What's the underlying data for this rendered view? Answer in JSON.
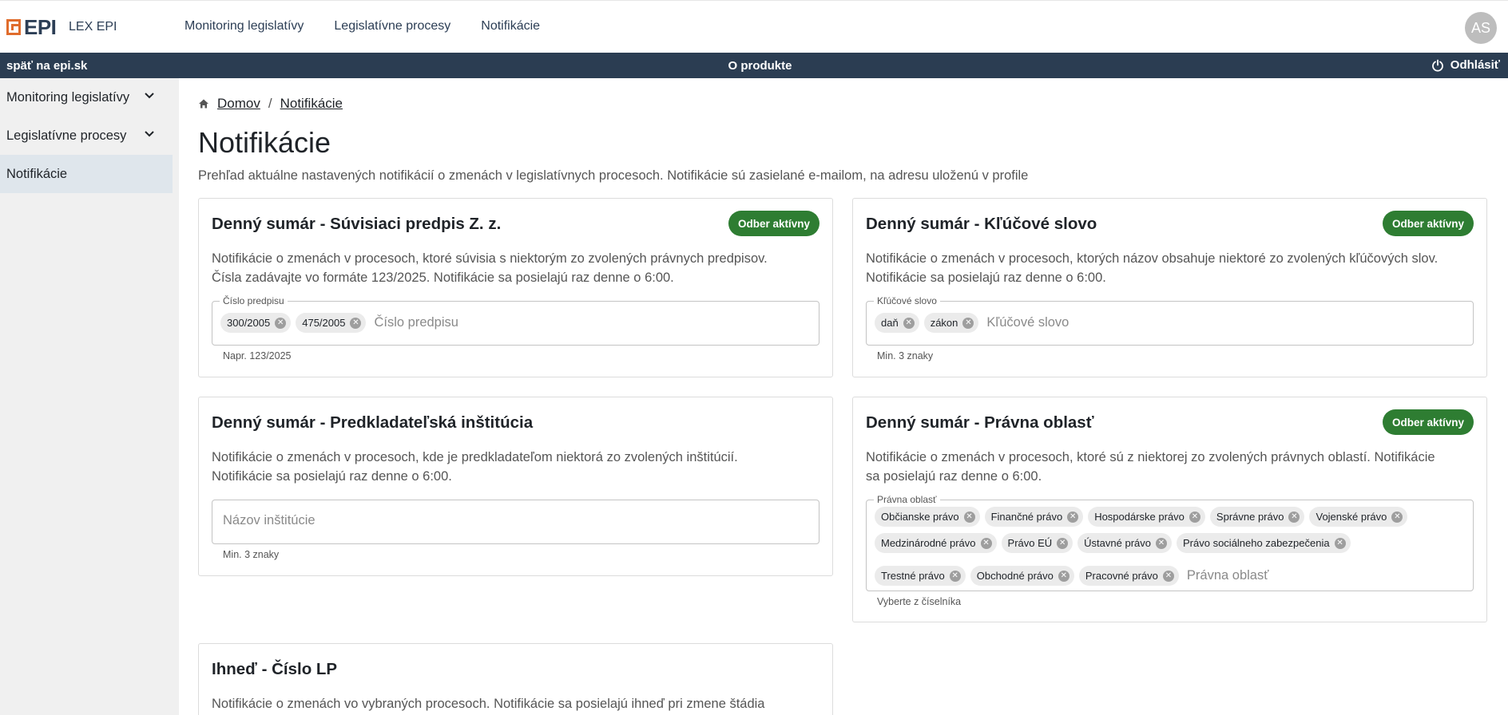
{
  "header": {
    "logo_text": "EPI",
    "product": "LEX EPI",
    "nav": [
      "Monitoring legislatívy",
      "Legislatívne procesy",
      "Notifikácie"
    ],
    "avatar": "AS"
  },
  "darkbar": {
    "back": "späť na epi.sk",
    "about": "O produkte",
    "logout": "Odhlásiť"
  },
  "sidebar": {
    "items": [
      {
        "label": "Monitoring legislatívy"
      },
      {
        "label": "Legislatívne procesy"
      },
      {
        "label": "Notifikácie"
      }
    ]
  },
  "breadcrumb": {
    "home": "Domov",
    "sep": "/",
    "current": "Notifikácie"
  },
  "page": {
    "title": "Notifikácie",
    "description": "Prehľad aktuálne nastavených notifikácií o zmenách v legislatívnych procesoch. Notifikácie sú zasielané e-mailom, na adresu uloženú v profile"
  },
  "cards": {
    "related": {
      "title": "Denný sumár - Súvisiaci predpis Z. z.",
      "badge": "Odber aktívny",
      "desc1": "Notifikácie o zmenách v procesoch, ktoré súvisia s niektorým zo zvolených právnych predpisov.",
      "desc2": "Čísla zadávajte vo formáte 123/2025. Notifikácie sa posielajú raz denne o 6:00.",
      "legend": "Číslo predpisu",
      "chips": [
        "300/2005",
        "475/2005"
      ],
      "placeholder": "Číslo predpisu",
      "helper": "Napr. 123/2025"
    },
    "keyword": {
      "title": "Denný sumár - Kľúčové slovo",
      "badge": "Odber aktívny",
      "desc1": "Notifikácie o zmenách v procesoch, ktorých názov obsahuje niektoré zo zvolených kľúčových slov.",
      "desc2": "Notifikácie sa posielajú raz denne o 6:00.",
      "legend": "Kľúčové slovo",
      "chips": [
        "daň",
        "zákon"
      ],
      "placeholder": "Kľúčové slovo",
      "helper": "Min. 3 znaky"
    },
    "institution": {
      "title": "Denný sumár - Predkladateľská inštitúcia",
      "desc1": "Notifikácie o zmenách v procesoch, kde je predkladateľom niektorá zo zvolených inštitúcií.",
      "desc2": "Notifikácie sa posielajú raz denne o 6:00.",
      "placeholder": "Názov inštitúcie",
      "helper": "Min. 3 znaky"
    },
    "area": {
      "title": "Denný sumár - Právna oblasť",
      "badge": "Odber aktívny",
      "desc1": "Notifikácie o zmenách v procesoch, ktoré sú z niektorej zo zvolených právnych oblastí. Notifikácie",
      "desc2": "sa posielajú raz denne o 6:00.",
      "legend": "Právna oblasť",
      "chips": [
        "Občianske právo",
        "Finančné právo",
        "Hospodárske právo",
        "Správne právo",
        "Vojenské právo",
        "Medzinárodné právo",
        "Právo EÚ",
        "Ústavné právo",
        "Právo sociálneho zabezpečenia",
        "Trestné právo",
        "Obchodné právo",
        "Pracovné právo"
      ],
      "placeholder": "Právna oblasť",
      "helper": "Vyberte z číselníka"
    },
    "immediate": {
      "title": "Ihneď - Číslo LP",
      "desc1": "Notifikácie o zmenách vo vybraných procesoch. Notifikácie sa posielajú ihneď pri zmene štádia"
    }
  },
  "colors": {
    "accent_orange": "#e06c2c",
    "navy": "#2b3d52",
    "badge_green": "#2e7d32",
    "sidebar_active": "#dfe6ec"
  }
}
